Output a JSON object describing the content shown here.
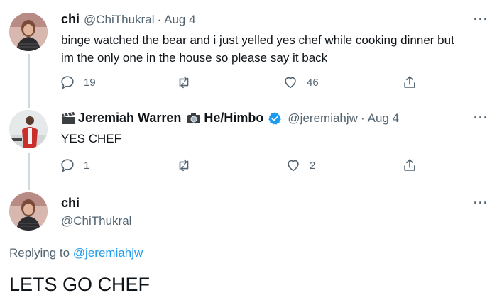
{
  "tweets": [
    {
      "name": "chi",
      "handle": "@ChiThukral",
      "date": "Aug 4",
      "text_line1": "binge watched the bear and i just yelled yes chef while cooking dinner but",
      "text_line2": "im the only one in the house so please say it back",
      "replies": "19",
      "likes": "46"
    },
    {
      "name": "Jeremiah Warren",
      "name_suffix": "He/Himbo",
      "handle": "@jeremiahjw",
      "date": "Aug 4",
      "text": "YES CHEF",
      "replies": "1",
      "likes": "2"
    }
  ],
  "focused": {
    "name": "chi",
    "handle": "@ChiThukral",
    "replying_prefix": "Replying to",
    "replying_handle": "@jeremiahjw",
    "text": "LETS GO CHEF"
  },
  "separator": "·",
  "more_label": "···",
  "colors": {
    "link": "#1d9bf0",
    "muted": "#536471",
    "thread_line": "#cfd9de",
    "verified": "#1d9bf0"
  },
  "icons": [
    "reply-icon",
    "retweet-icon",
    "like-icon",
    "share-icon",
    "clapper-emoji-icon",
    "camera-emoji-icon",
    "verified-icon",
    "more-icon"
  ]
}
